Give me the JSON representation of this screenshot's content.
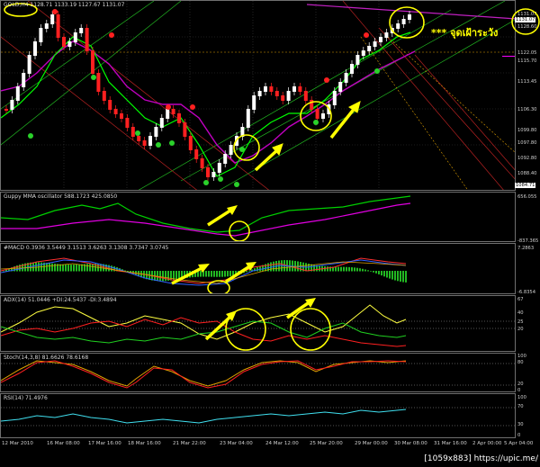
{
  "main": {
    "title": "GOLD,H4  1128.71 1133.19 1127.67 1131.07",
    "annotation": "*** จุดเฝ้าระวัง",
    "scale": [
      "1131.07",
      "1128.60",
      "1122.05",
      "1115.70",
      "1113.45",
      "1106.30",
      "1099.80",
      "1097.80",
      "1092.80",
      "1088.40",
      "1084.71"
    ],
    "current_price": "1131.07",
    "low_price": "1084.71"
  },
  "guppy": {
    "title": "Guppy MMA oscillator 588.1723 425.0850",
    "scale": [
      "656.055",
      "-837.365"
    ]
  },
  "macd": {
    "title": "#MACD 0.3936 3.5449 3.1513 3.6263 3.1308 3.7347 3.0745",
    "scale": [
      "7.2863",
      "-6.8354"
    ]
  },
  "adx": {
    "title": "ADX(14) 51.0446 +DI:24.5437 -DI:3.4894",
    "scale": [
      "67",
      "40",
      "25",
      "20"
    ]
  },
  "stoch": {
    "title": "Stoch(14,3,8) 81.6626 78.6168",
    "scale": [
      "100",
      "80",
      "20",
      "0"
    ]
  },
  "rsi": {
    "title": "RSI(14) 71.4976",
    "scale": [
      "100",
      "70",
      "30",
      "0"
    ]
  },
  "xaxis": [
    "12 Mar 2010",
    "16 Mar 08:00",
    "17 Mar 16:00",
    "18 Mar 16:00",
    "21 Mar 22:00",
    "23 Mar 04:00",
    "24 Mar 12:00",
    "25 Mar 20:00",
    "29 Mar 00:00",
    "30 Mar 08:00",
    "31 Mar 16:00",
    "2 Apr 00:00",
    "5 Apr 04:00"
  ],
  "watermark": "[1059x883] https://upic.me/",
  "colors": {
    "up": "#ffffff",
    "down": "#ff2020",
    "ma_fast": "#00ff00",
    "ma_slow": "#ff00ff",
    "highlight": "#ffff00"
  }
}
